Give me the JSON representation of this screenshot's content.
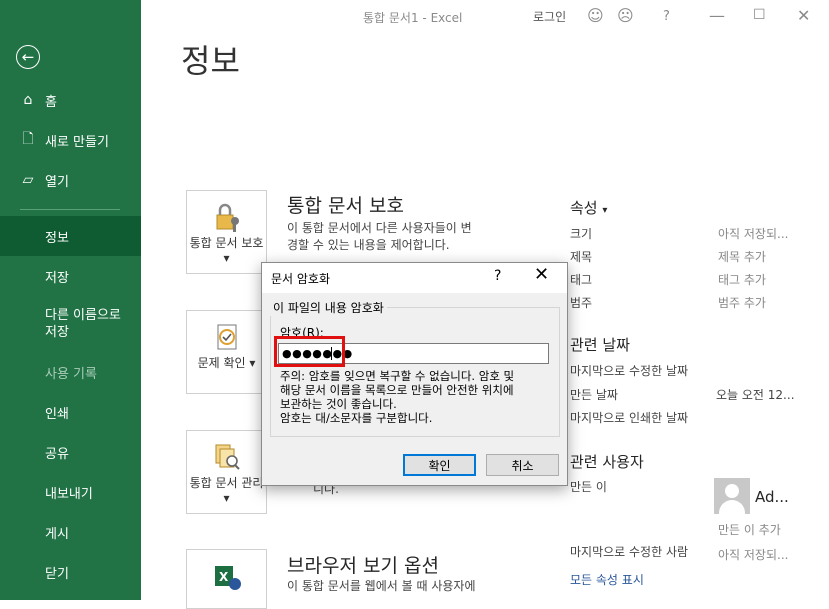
{
  "window": {
    "title": "통합 문서1 - Excel",
    "login": "로그인"
  },
  "sidebar": {
    "items": [
      {
        "label": "홈"
      },
      {
        "label": "새로 만들기"
      },
      {
        "label": "열기"
      },
      {
        "label": "정보"
      },
      {
        "label": "저장"
      },
      {
        "label": "다른 이름으로 저장"
      },
      {
        "label": "사용 기록"
      },
      {
        "label": "인쇄"
      },
      {
        "label": "공유"
      },
      {
        "label": "내보내기"
      },
      {
        "label": "게시"
      },
      {
        "label": "닫기"
      }
    ]
  },
  "main": {
    "title": "정보",
    "sections": [
      {
        "button": "통합 문서 보호",
        "title": "통합 문서 보호",
        "desc": [
          "이 통합 문서에서 다른 사용자들이 변",
          "경할 수 있는 내용을 제어합니다."
        ]
      },
      {
        "button": "문제 확인",
        "title": "",
        "desc": []
      },
      {
        "button": "통합 문서 관리",
        "title": "",
        "desc": [
          "니다."
        ]
      },
      {
        "button": "브라우저 보기 옵션",
        "title": "브라우저 보기 옵션",
        "desc": [
          "이 통합 문서를 웹에서 볼 때 사용자에"
        ]
      }
    ]
  },
  "properties": {
    "header": "속성",
    "rows": [
      {
        "label": "크기",
        "value": "아직 저장되..."
      },
      {
        "label": "제목",
        "value": "제목 추가"
      },
      {
        "label": "태그",
        "value": "태그 추가"
      },
      {
        "label": "범주",
        "value": "범주 추가"
      }
    ],
    "dates_header": "관련 날짜",
    "dates": [
      {
        "label": "마지막으로 수정한 날짜",
        "value": ""
      },
      {
        "label": "만든 날짜",
        "value": "오늘 오전 12..."
      },
      {
        "label": "마지막으로 인쇄한 날짜",
        "value": ""
      }
    ],
    "people_header": "관련 사용자",
    "author_label": "만든 이",
    "author_name": "Ad...",
    "add_author": "만든 이 추가",
    "last_modified_by_label": "마지막으로 수정한 사람",
    "last_modified_by_value": "아직 저장되...",
    "show_all": "모든 속성 표시"
  },
  "dialog": {
    "title": "문서 암호화",
    "help": "?",
    "group_label": "이 파일의 내용 암호화",
    "password_label": "암호(R):",
    "password_value": "●●●●●●●",
    "warning": [
      "주의: 암호를 잊으면 복구할 수 없습니다. 암호 및",
      "해당 문서 이름을 목록으로 만들어 안전한 위치에",
      "보관하는 것이 좋습니다.",
      "암호는 대/소문자를 구분합니다."
    ],
    "ok": "확인",
    "cancel": "취소"
  }
}
